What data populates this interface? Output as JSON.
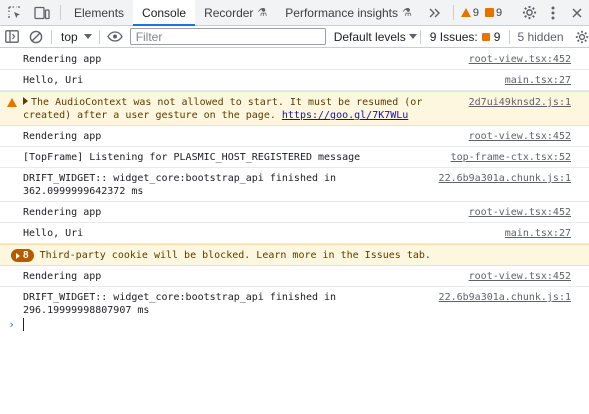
{
  "tabs": [
    {
      "label": "Elements"
    },
    {
      "label": "Console"
    },
    {
      "label": "Recorder",
      "flask": "⚗"
    },
    {
      "label": "Performance insights",
      "flask": "⚗"
    }
  ],
  "counters": {
    "warnings": "9",
    "issues": "9"
  },
  "toolbar": {
    "context": "top",
    "filter_placeholder": "Filter",
    "levels": "Default levels",
    "issues_label": "9 Issues:",
    "issues_count": "9",
    "hidden": "5 hidden"
  },
  "messages": [
    {
      "type": "log",
      "text": "Rendering app",
      "source": "root-view.tsx:452"
    },
    {
      "type": "log",
      "text": "Hello, Uri",
      "source": "main.tsx:27"
    },
    {
      "type": "warn",
      "text_a": "The AudioContext was not allowed to start. It must be resumed (or\ncreated) after a user gesture on the page. ",
      "link": "https://goo.gl/7K7WLu",
      "source": "2d7ui49knsd2.js:1"
    },
    {
      "type": "log",
      "text": "Rendering app",
      "source": "root-view.tsx:452"
    },
    {
      "type": "log",
      "text": "[TopFrame] Listening for PLASMIC_HOST_REGISTERED message",
      "source": "top-frame-ctx.tsx:52"
    },
    {
      "type": "log",
      "text": "DRIFT_WIDGET:: widget_core:bootstrap_api finished in\n362.0999999642372 ms",
      "source": "22.6b9a301a.chunk.js:1"
    },
    {
      "type": "log",
      "text": "Rendering app",
      "source": "root-view.tsx:452"
    },
    {
      "type": "log",
      "text": "Hello, Uri",
      "source": "main.tsx:27"
    },
    {
      "type": "issue",
      "badge": "8",
      "text": "Third-party cookie will be blocked. Learn more in the Issues tab."
    },
    {
      "type": "log",
      "text": "Rendering app",
      "source": "root-view.tsx:452"
    },
    {
      "type": "log",
      "text": "DRIFT_WIDGET:: widget_core:bootstrap_api finished in\n296.19999998807907 ms",
      "source": "22.6b9a301a.chunk.js:1"
    }
  ],
  "prompt_symbol": "›",
  "icons": {
    "inspect": "inspect-element-icon",
    "device": "device-toolbar-icon",
    "more_tabs": "more-tabs-icon",
    "settings": "gear-icon",
    "menu": "kebab-menu-icon",
    "close": "close-icon",
    "sidebar": "sidebar-toggle-icon",
    "clear": "clear-console-icon",
    "eye": "live-expression-icon"
  },
  "colors": {
    "accent": "#1a73e8",
    "warning": "#e37400",
    "warn_bg": "#fef7e0",
    "issue_badge": "#b45a00"
  }
}
